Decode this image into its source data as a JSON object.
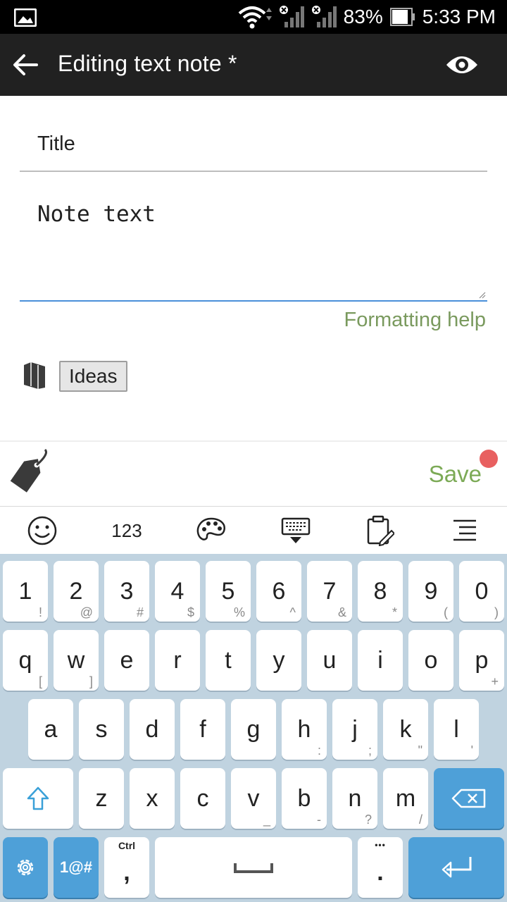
{
  "status_bar": {
    "battery": "83%",
    "time": "5:33 PM"
  },
  "app_bar": {
    "title": "Editing text note *",
    "back_icon": "arrow-left-icon",
    "preview_icon": "eye-icon"
  },
  "editor": {
    "title_placeholder": "Title",
    "note_placeholder": "Note text",
    "formatting_help": "Formatting help",
    "notebook_icon": "notebook-icon",
    "tag": "Ideas"
  },
  "bottom_bar": {
    "tag_icon": "tag-icon",
    "save_label": "Save"
  },
  "keyboard_toolbar": {
    "emoji_icon": "emoji-icon",
    "numbers_label": "123",
    "palette_icon": "palette-icon",
    "hide_keyboard_icon": "keyboard-hide-icon",
    "clipboard_icon": "clipboard-icon",
    "menu_icon": "menu-icon"
  },
  "keyboard": {
    "row1": [
      {
        "main": "1",
        "sub": "!"
      },
      {
        "main": "2",
        "sub": "@"
      },
      {
        "main": "3",
        "sub": "#"
      },
      {
        "main": "4",
        "sub": "$"
      },
      {
        "main": "5",
        "sub": "%"
      },
      {
        "main": "6",
        "sub": "^"
      },
      {
        "main": "7",
        "sub": "&"
      },
      {
        "main": "8",
        "sub": "*"
      },
      {
        "main": "9",
        "sub": "("
      },
      {
        "main": "0",
        "sub": ")"
      }
    ],
    "row2": [
      {
        "main": "q",
        "sub": "["
      },
      {
        "main": "w",
        "sub": "]"
      },
      {
        "main": "e",
        "sub": ""
      },
      {
        "main": "r",
        "sub": ""
      },
      {
        "main": "t",
        "sub": ""
      },
      {
        "main": "y",
        "sub": ""
      },
      {
        "main": "u",
        "sub": ""
      },
      {
        "main": "i",
        "sub": ""
      },
      {
        "main": "o",
        "sub": ""
      },
      {
        "main": "p",
        "sub": "+"
      }
    ],
    "row3": [
      {
        "main": "a",
        "sub": ""
      },
      {
        "main": "s",
        "sub": ""
      },
      {
        "main": "d",
        "sub": ""
      },
      {
        "main": "f",
        "sub": ""
      },
      {
        "main": "g",
        "sub": ""
      },
      {
        "main": "h",
        "sub": ":"
      },
      {
        "main": "j",
        "sub": ";"
      },
      {
        "main": "k",
        "sub": "\""
      },
      {
        "main": "l",
        "sub": "'"
      }
    ],
    "row4": [
      {
        "main": "z",
        "sub": ""
      },
      {
        "main": "x",
        "sub": ""
      },
      {
        "main": "c",
        "sub": ""
      },
      {
        "main": "v",
        "sub": "_"
      },
      {
        "main": "b",
        "sub": "-"
      },
      {
        "main": "n",
        "sub": "?"
      },
      {
        "main": "m",
        "sub": "/"
      }
    ],
    "symbols_label": "1@#",
    "ctrl_label": "Ctrl",
    "comma": ",",
    "period": ".",
    "period_sub": "•••"
  }
}
